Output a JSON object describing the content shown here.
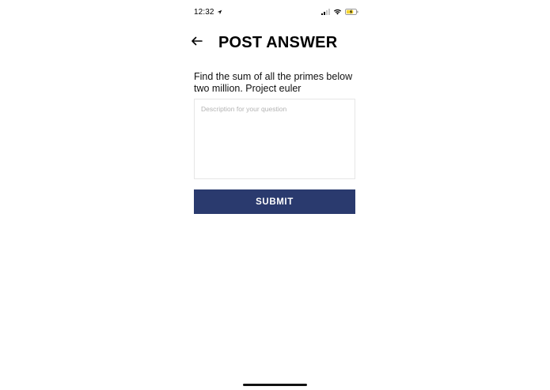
{
  "status_bar": {
    "time": "12:32",
    "location_icon": "location-arrow-icon",
    "signal_icon": "cellular-signal-icon",
    "wifi_icon": "wifi-icon",
    "battery_icon": "battery-charging-icon"
  },
  "header": {
    "back_icon": "arrow-left-icon",
    "title": "POST ANSWER"
  },
  "question": {
    "text": "Find the sum of all the primes below two million. Project euler"
  },
  "answer_input": {
    "placeholder": "Description for your question",
    "value": ""
  },
  "submit": {
    "label": "SUBMIT"
  },
  "colors": {
    "submit_background": "#2a3a6e",
    "battery_fill": "#f2d230"
  }
}
